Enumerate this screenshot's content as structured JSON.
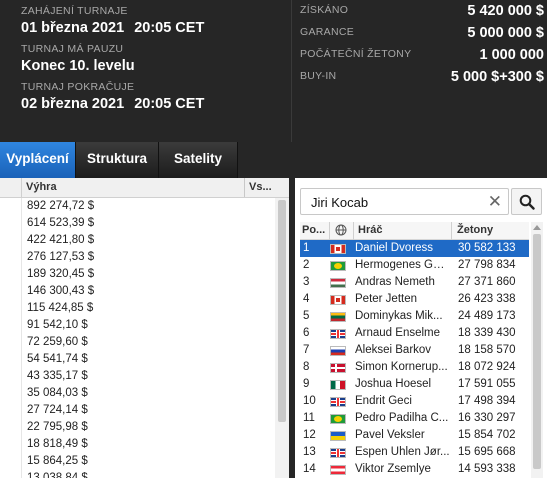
{
  "info": {
    "start_label": "ZAHÁJENÍ TURNAJE",
    "start_date": "01 března 2021",
    "start_time": "20:05 CET",
    "pause_label": "TURNAJ Má PAUZU",
    "pause_value": "Konec 10. levelu",
    "resume_label": "TURNAJ POKRAČUJE",
    "resume_date": "02 března 2021",
    "resume_time": "20:05 CET"
  },
  "stats": [
    {
      "label": "ZÍSKÁNO",
      "value": "5 420 000 $"
    },
    {
      "label": "GARANCE",
      "value": "5 000 000 $"
    },
    {
      "label": "POČÁTEČNÍ ŽETONY",
      "value": "1 000 000"
    },
    {
      "label": "BUY-IN",
      "value": "5 000 $+300 $"
    }
  ],
  "tabs": [
    {
      "label": "Vyplácení",
      "active": true
    },
    {
      "label": "Struktura",
      "active": false
    },
    {
      "label": "Satelity",
      "active": false
    }
  ],
  "payouts": {
    "col_prize": "Výhra",
    "col_vs": "Vs...",
    "rows": [
      "892 274,72 $",
      "614 523,39 $",
      "422 421,80 $",
      "276 127,53 $",
      "189 320,45 $",
      "146 300,43 $",
      "115 424,85 $",
      "91 542,10 $",
      "72 259,60 $",
      "54 541,74 $",
      "43 335,17 $",
      "35 084,03 $",
      "27 724,14 $",
      "22 795,98 $",
      "18 818,49 $",
      "15 864,25 $",
      "13 038,84 $"
    ]
  },
  "players": {
    "search_value": "Jiri Kocab",
    "col_pos": "Po...",
    "col_player": "Hráč",
    "col_chips": "Žetony",
    "rows": [
      {
        "pos": "1",
        "flag": "ca",
        "name": "Daniel Dvoress",
        "chips": "30 582 133",
        "selected": true
      },
      {
        "pos": "2",
        "flag": "br",
        "name": "Hermogenes Gel...",
        "chips": "27 798 834"
      },
      {
        "pos": "3",
        "flag": "hu",
        "name": "Andras Nemeth",
        "chips": "27 371 860"
      },
      {
        "pos": "4",
        "flag": "ca",
        "name": "Peter Jetten",
        "chips": "26 423 338"
      },
      {
        "pos": "5",
        "flag": "lt",
        "name": "Dominykas Mik...",
        "chips": "24 489 173"
      },
      {
        "pos": "6",
        "flag": "gb",
        "name": "Arnaud Enselme",
        "chips": "18 339 430"
      },
      {
        "pos": "7",
        "flag": "ru",
        "name": "Aleksei Barkov",
        "chips": "18 158 570"
      },
      {
        "pos": "8",
        "flag": "dk",
        "name": "Simon Kornerup...",
        "chips": "18 072 924"
      },
      {
        "pos": "9",
        "flag": "mx",
        "name": "Joshua Hoesel",
        "chips": "17 591 055"
      },
      {
        "pos": "10",
        "flag": "gb",
        "name": "Endrit Geci",
        "chips": "17 498 394"
      },
      {
        "pos": "11",
        "flag": "br",
        "name": "Pedro Padilha C...",
        "chips": "16 330 297"
      },
      {
        "pos": "12",
        "flag": "ua",
        "name": "Pavel Veksler",
        "chips": "15 854 702"
      },
      {
        "pos": "13",
        "flag": "gb",
        "name": "Espen Uhlen Jør...",
        "chips": "15 695 668"
      },
      {
        "pos": "14",
        "flag": "at",
        "name": "Viktor Zsemlye",
        "chips": "14 593 338"
      }
    ]
  }
}
